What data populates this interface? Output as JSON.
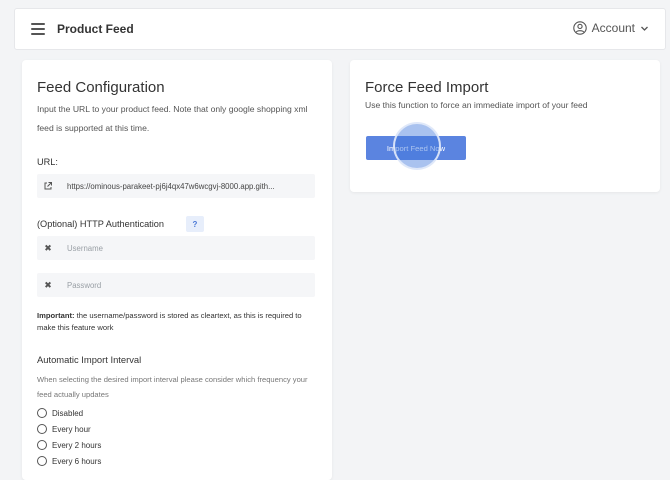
{
  "header": {
    "title": "Product Feed",
    "menu_icon": "hamburger-icon",
    "account_label": "Account",
    "account_icon": "user-circle-icon",
    "account_chevron": "chevron-down-icon"
  },
  "feed_config": {
    "title": "Feed Configuration",
    "description": "Input the URL to your product feed. Note that only google shopping xml feed is supported at this time.",
    "url_label": "URL:",
    "url_icon": "external-link-icon",
    "url_value": "https://ominous-parakeet-pj6j4qx47w6wcgvj-8000.app.gith...",
    "auth_label": "(Optional) HTTP Authentication",
    "auth_help": "?",
    "username_placeholder": "Username",
    "password_placeholder": "Password",
    "note_strong": "Important:",
    "note_text": " the username/password is stored as cleartext, as this is required to make this feature work",
    "interval_title": "Automatic Import Interval",
    "interval_desc": "When selecting the desired import interval please consider which frequency your feed actually updates",
    "interval_options": [
      "Disabled",
      "Every hour",
      "Every 2 hours",
      "Every 6 hours"
    ]
  },
  "force_import": {
    "title": "Force Feed Import",
    "description": "Use this function to force an immediate import of your feed",
    "button_label": "Import Feed Now"
  },
  "colors": {
    "accent": "#5b84e0",
    "background": "#f3f4f6",
    "card": "#ffffff"
  }
}
